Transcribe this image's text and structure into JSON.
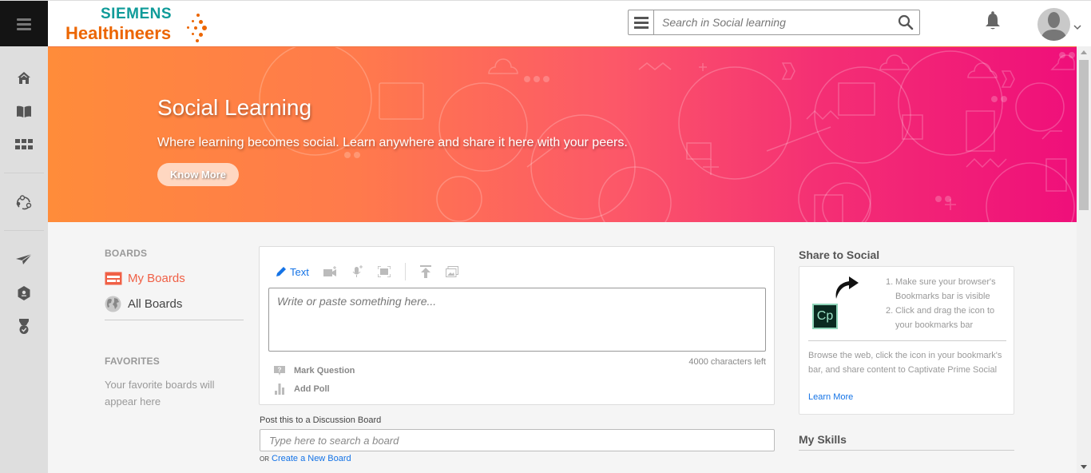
{
  "header": {
    "logo_top": "SIEMENS",
    "logo_bottom": "Healthineers",
    "search_placeholder": "Search in Social learning",
    "search_value": ""
  },
  "nav": {
    "items": [
      {
        "name": "home",
        "icon": "home-icon"
      },
      {
        "name": "catalog",
        "icon": "book-icon"
      },
      {
        "name": "apps",
        "icon": "grid-icon"
      },
      {
        "name": "social",
        "icon": "social-network-icon"
      },
      {
        "name": "share",
        "icon": "paper-plane-icon"
      },
      {
        "name": "skills",
        "icon": "badge-hexagon-icon"
      },
      {
        "name": "achievements",
        "icon": "medal-icon"
      }
    ]
  },
  "banner": {
    "title": "Social Learning",
    "subtitle": "Where learning becomes social. Learn anywhere and share it here with your peers.",
    "button": "Know More",
    "gradient_start": "#ff8c3a",
    "gradient_end": "#ef0f7a"
  },
  "boards": {
    "section_label": "BOARDS",
    "my_boards": "My Boards",
    "all_boards": "All Boards",
    "favorites_label": "FAVORITES",
    "favorites_empty": "Your favorite boards will appear here",
    "active_color": "#f06046"
  },
  "composer": {
    "text_tab": "Text",
    "tools": [
      "video-add-icon",
      "microphone-add-icon",
      "screen-capture-icon",
      "upload-icon",
      "gallery-icon"
    ],
    "placeholder": "Write or paste something here...",
    "value": "",
    "chars_left": "4000 characters left",
    "mark_question": "Mark Question",
    "add_poll": "Add Poll",
    "accent_color": "#1473e6"
  },
  "post_to": {
    "label": "Post this to a Discussion Board",
    "placeholder": "Type here to search a board",
    "value": "",
    "or_text": "OR",
    "create_link": "Create a New Board"
  },
  "share": {
    "title": "Share to Social",
    "icon_label": "Cp",
    "steps": [
      {
        "num": "1.",
        "text": "Make sure your browser's Bookmarks bar is visible"
      },
      {
        "num": "2.",
        "text": "Click and drag the icon to your bookmarks bar"
      }
    ],
    "description": "Browse the web, click the icon in your bookmark's bar, and share content to Captivate Prime Social",
    "learn_more": "Learn More"
  },
  "skills": {
    "title": "My Skills"
  }
}
